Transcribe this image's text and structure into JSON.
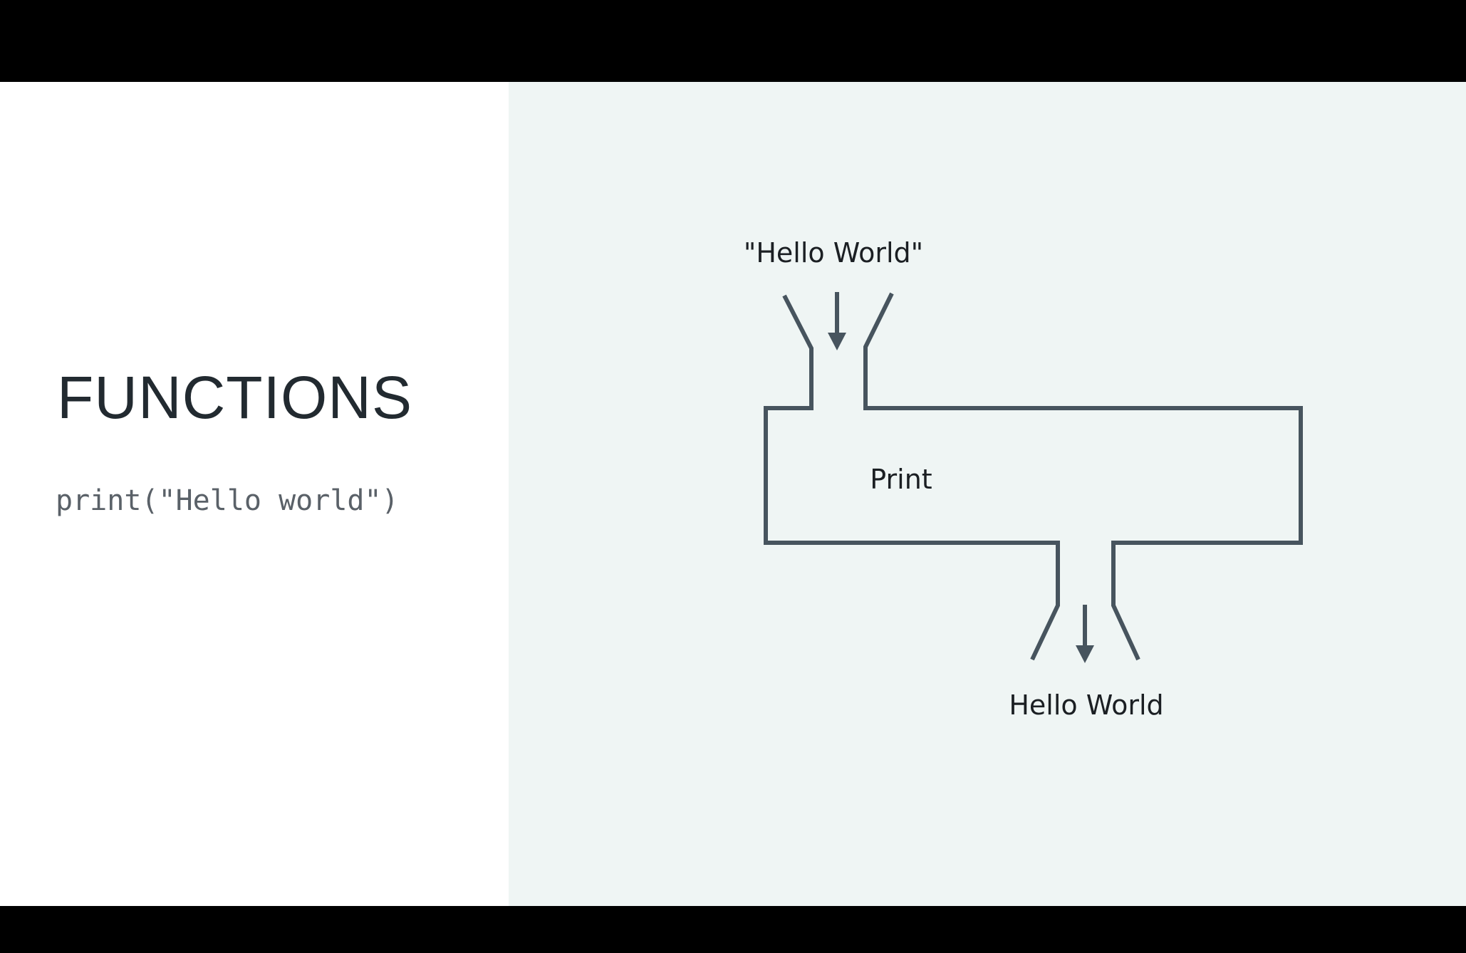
{
  "slide": {
    "title": "FUNCTIONS",
    "code": "print(\"Hello world\")"
  },
  "diagram": {
    "input_label": "\"Hello World\"",
    "function_label": "Print",
    "output_label": "Hello World",
    "line_color": "#47545e",
    "background_color": "#eff5f4"
  }
}
